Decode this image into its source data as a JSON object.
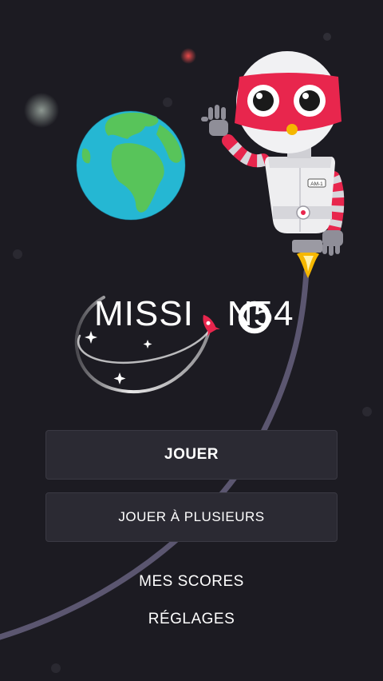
{
  "colors": {
    "background": "#1c1b22",
    "button_bg": "#2b2a33",
    "robot_red": "#e8264d",
    "earth_ocean": "#25b7d3",
    "earth_land": "#58c45a",
    "trail": "#5b5670"
  },
  "logo": {
    "text_left": "MISSI",
    "text_right": "N54"
  },
  "menu": {
    "play_label": "JOUER",
    "multiplayer_label": "JOUER À PLUSIEURS",
    "scores_label": "MES SCORES",
    "settings_label": "RÉGLAGES"
  },
  "robot": {
    "chest_badge": "AM-1"
  }
}
